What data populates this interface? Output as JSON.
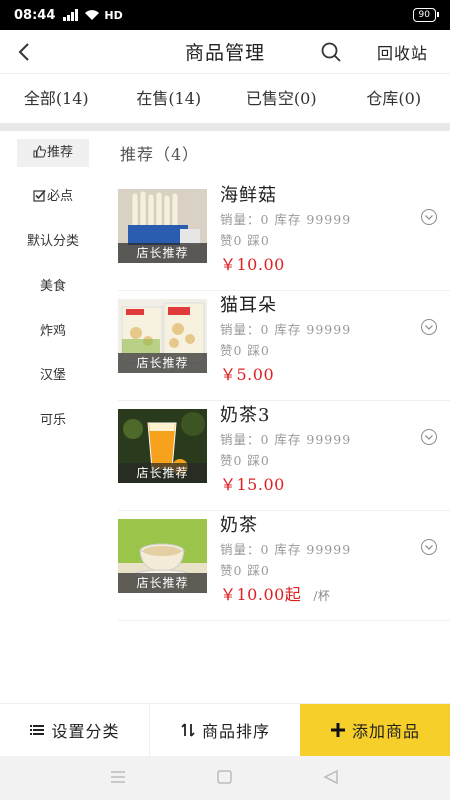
{
  "status": {
    "time": "08:44",
    "network": "HD",
    "battery": "90"
  },
  "header": {
    "title": "商品管理",
    "recycle_label": "回收站"
  },
  "tabs": [
    {
      "label": "全部(14)"
    },
    {
      "label": "在售(14)"
    },
    {
      "label": "已售空(0)"
    },
    {
      "label": "仓库(0)"
    }
  ],
  "sidebar": {
    "items": [
      {
        "label": "推荐",
        "icon": "thumbs-up-icon"
      },
      {
        "label": "必点",
        "icon": "checkbox-icon"
      },
      {
        "label": "默认分类"
      },
      {
        "label": "美食"
      },
      {
        "label": "炸鸡"
      },
      {
        "label": "汉堡"
      },
      {
        "label": "可乐"
      }
    ]
  },
  "main": {
    "section_title": "推荐（4）",
    "products": [
      {
        "name": "海鲜菇",
        "stats": "销量：0  库存 99999",
        "likes": "赞0  踩0",
        "price": "￥10.00",
        "unit": "",
        "badge": "店长推荐"
      },
      {
        "name": "猫耳朵",
        "stats": "销量：0  库存 99999",
        "likes": "赞0  踩0",
        "price": "￥5.00",
        "unit": "",
        "badge": "店长推荐"
      },
      {
        "name": "奶茶3",
        "stats": "销量：0  库存 99999",
        "likes": "赞0  踩0",
        "price": "￥15.00",
        "unit": "",
        "badge": "店长推荐"
      },
      {
        "name": "奶茶",
        "stats": "销量：0  库存 99999",
        "likes": "赞0  踩0",
        "price": "￥10.00起",
        "unit": "/杯",
        "badge": "店长推荐"
      }
    ]
  },
  "bottom": {
    "set_category": "设置分类",
    "sort_products": "商品排序",
    "add_product": "添加商品"
  },
  "colors": {
    "accent": "#f7cf2a",
    "price": "#e02020"
  }
}
